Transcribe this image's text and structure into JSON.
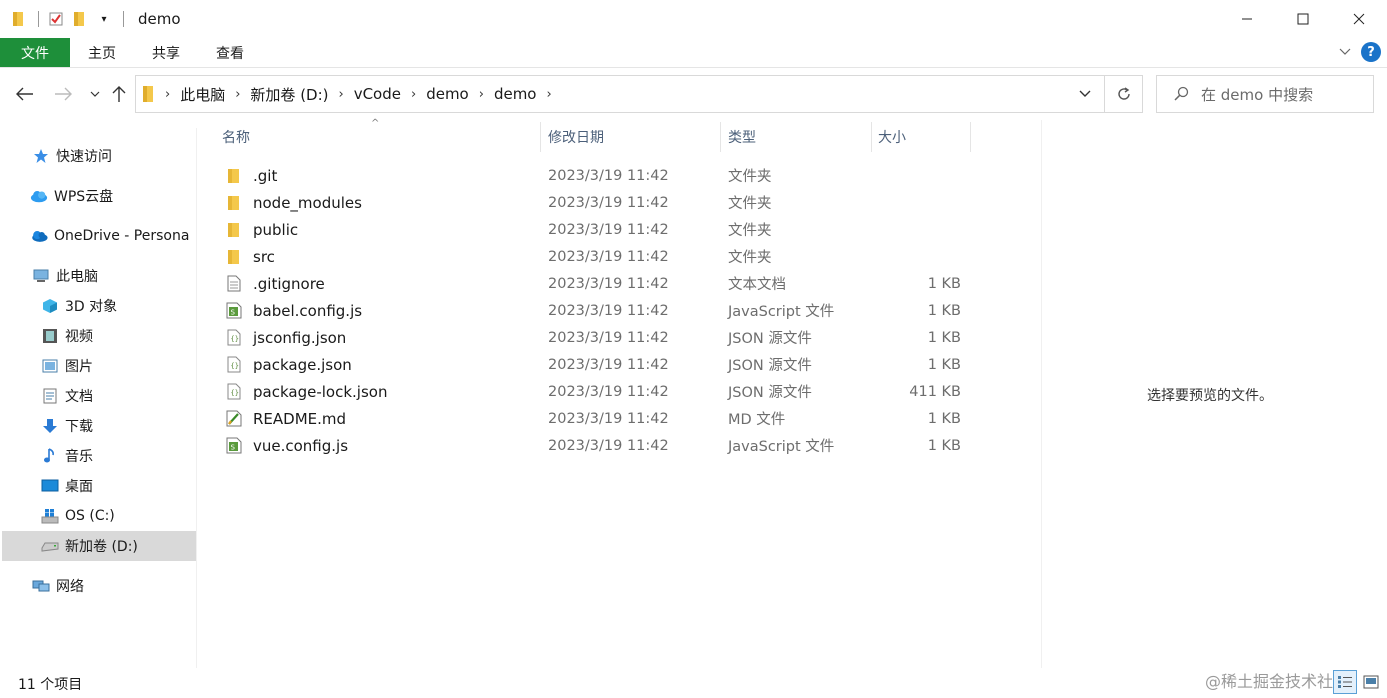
{
  "window": {
    "title": "demo"
  },
  "ribbon": {
    "tabs": [
      "文件",
      "主页",
      "共享",
      "查看"
    ]
  },
  "breadcrumb": [
    "此电脑",
    "新加卷 (D:)",
    "vCode",
    "demo",
    "demo"
  ],
  "search": {
    "placeholder": "在 demo 中搜索"
  },
  "sidebar": {
    "items": [
      {
        "label": "快速访问",
        "icon": "star-icon"
      },
      {
        "label": "WPS云盘",
        "icon": "cloud-icon"
      },
      {
        "label": "OneDrive - Persona",
        "icon": "onedrive-icon"
      },
      {
        "label": "此电脑",
        "icon": "computer-icon"
      },
      {
        "label": "3D 对象",
        "icon": "cube-icon"
      },
      {
        "label": "视频",
        "icon": "video-icon"
      },
      {
        "label": "图片",
        "icon": "picture-icon"
      },
      {
        "label": "文档",
        "icon": "document-icon"
      },
      {
        "label": "下载",
        "icon": "download-icon"
      },
      {
        "label": "音乐",
        "icon": "music-icon"
      },
      {
        "label": "桌面",
        "icon": "desktop-icon"
      },
      {
        "label": "OS (C:)",
        "icon": "windows-drive-icon"
      },
      {
        "label": "新加卷 (D:)",
        "icon": "drive-icon"
      },
      {
        "label": "网络",
        "icon": "network-icon"
      }
    ],
    "selected": "新加卷 (D:)"
  },
  "columns": {
    "name": "名称",
    "date": "修改日期",
    "type": "类型",
    "size": "大小"
  },
  "files": [
    {
      "name": ".git",
      "date": "2023/3/19 11:42",
      "type": "文件夹",
      "size": "",
      "icon": "folder-icon"
    },
    {
      "name": "node_modules",
      "date": "2023/3/19 11:42",
      "type": "文件夹",
      "size": "",
      "icon": "folder-icon"
    },
    {
      "name": "public",
      "date": "2023/3/19 11:42",
      "type": "文件夹",
      "size": "",
      "icon": "folder-icon"
    },
    {
      "name": "src",
      "date": "2023/3/19 11:42",
      "type": "文件夹",
      "size": "",
      "icon": "folder-icon"
    },
    {
      "name": ".gitignore",
      "date": "2023/3/19 11:42",
      "type": "文本文档",
      "size": "1 KB",
      "icon": "text-file-icon"
    },
    {
      "name": "babel.config.js",
      "date": "2023/3/19 11:42",
      "type": "JavaScript 文件",
      "size": "1 KB",
      "icon": "js-file-icon"
    },
    {
      "name": "jsconfig.json",
      "date": "2023/3/19 11:42",
      "type": "JSON 源文件",
      "size": "1 KB",
      "icon": "json-file-icon"
    },
    {
      "name": "package.json",
      "date": "2023/3/19 11:42",
      "type": "JSON 源文件",
      "size": "1 KB",
      "icon": "json-file-icon"
    },
    {
      "name": "package-lock.json",
      "date": "2023/3/19 11:42",
      "type": "JSON 源文件",
      "size": "411 KB",
      "icon": "json-file-icon"
    },
    {
      "name": "README.md",
      "date": "2023/3/19 11:42",
      "type": "MD 文件",
      "size": "1 KB",
      "icon": "md-file-icon"
    },
    {
      "name": "vue.config.js",
      "date": "2023/3/19 11:42",
      "type": "JavaScript 文件",
      "size": "1 KB",
      "icon": "js-file-icon"
    }
  ],
  "preview": {
    "message": "选择要预览的文件。"
  },
  "status": {
    "count": "11 个项目"
  },
  "watermark": "@稀土掘金技术社区",
  "colors": {
    "file_tab": "#1e8f3a",
    "folder": "#f4c84b",
    "selected_bg": "#d9d9d9",
    "accent": "#1a73c9"
  }
}
